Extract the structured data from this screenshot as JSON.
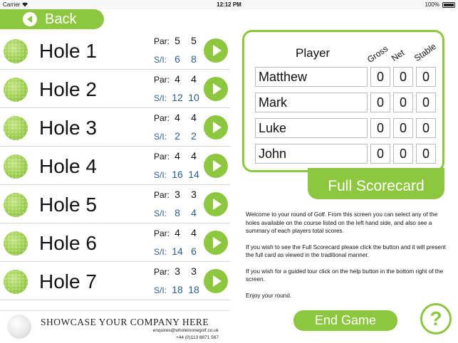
{
  "status_bar": {
    "carrier": "Carrier",
    "time": "12:12 PM",
    "battery": "100%"
  },
  "back_label": "Back",
  "holes": [
    {
      "name": "Hole 1",
      "par_label": "Par:",
      "par": [
        "5",
        "5"
      ],
      "si_label": "S/I:",
      "si": [
        "6",
        "8"
      ]
    },
    {
      "name": "Hole 2",
      "par_label": "Par:",
      "par": [
        "4",
        "4"
      ],
      "si_label": "S/I:",
      "si": [
        "12",
        "10"
      ]
    },
    {
      "name": "Hole 3",
      "par_label": "Par:",
      "par": [
        "4",
        "4"
      ],
      "si_label": "S/I:",
      "si": [
        "2",
        "2"
      ]
    },
    {
      "name": "Hole 4",
      "par_label": "Par:",
      "par": [
        "4",
        "4"
      ],
      "si_label": "S/I:",
      "si": [
        "16",
        "14"
      ]
    },
    {
      "name": "Hole 5",
      "par_label": "Par:",
      "par": [
        "3",
        "3"
      ],
      "si_label": "S/I:",
      "si": [
        "8",
        "4"
      ]
    },
    {
      "name": "Hole 6",
      "par_label": "Par:",
      "par": [
        "4",
        "4"
      ],
      "si_label": "S/I:",
      "si": [
        "14",
        "6"
      ]
    },
    {
      "name": "Hole 7",
      "par_label": "Par:",
      "par": [
        "3",
        "3"
      ],
      "si_label": "S/I:",
      "si": [
        "18",
        "18"
      ]
    }
  ],
  "ad": {
    "headline": "SHOWCASE YOUR COMPANY HERE",
    "email": "enquires@wholeinonegolf.co.uk",
    "phone": "+44 (0)113 8871 567"
  },
  "summary": {
    "player_header": "Player",
    "col_gross": "Gross",
    "col_net": "Net",
    "col_stable": "Stable",
    "players": [
      {
        "name": "Matthew",
        "gross": "0",
        "net": "0",
        "stable": "0"
      },
      {
        "name": "Mark",
        "gross": "0",
        "net": "0",
        "stable": "0"
      },
      {
        "name": "Luke",
        "gross": "0",
        "net": "0",
        "stable": "0"
      },
      {
        "name": "John",
        "gross": "0",
        "net": "0",
        "stable": "0"
      }
    ]
  },
  "full_scorecard_label": "Full Scorecard",
  "info": {
    "p1": "Welcome to your round of Golf. From this screen you can select any of the holes available on the course listed on the left hand side, and also see a summary of each players total scores.",
    "p2": "If you wish to see the Full Scorecard please click the button and it will present the full card as viewed in the traditional manner.",
    "p3": "If you wish for a guided tour click on the help button in the bottom right of the screen.",
    "p4": "Enjoy your round."
  },
  "end_game_label": "End Game",
  "help_label": "?",
  "colors": {
    "accent": "#8dc63f",
    "si_text": "#2e5c8c"
  }
}
